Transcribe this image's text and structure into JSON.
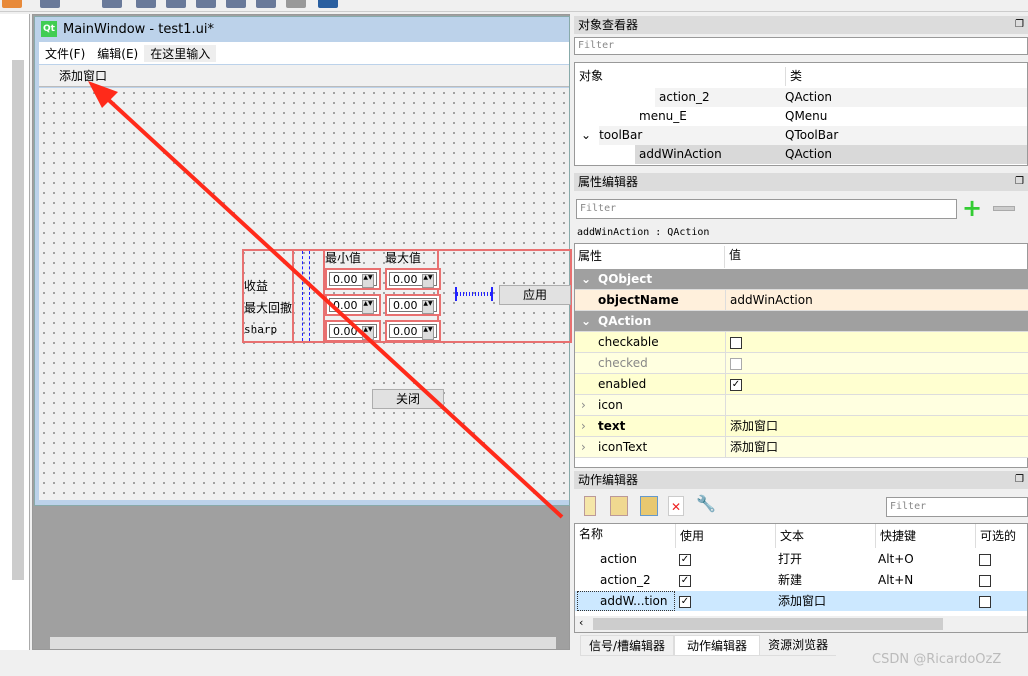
{
  "form_window": {
    "title": "MainWindow - test1.ui*",
    "logo": "Qt",
    "menus": [
      "文件(F)",
      "编辑(E)",
      "在这里输入"
    ],
    "toolbar_action": "添加窗口"
  },
  "form": {
    "labels": [
      "收益",
      "最大回撤",
      "sharp"
    ],
    "headers": [
      "最小值",
      "最大值"
    ],
    "spin_values": [
      "0.00",
      "0.00",
      "0.00",
      "0.00",
      "0.00",
      "0.00"
    ],
    "apply_button": "应用",
    "close_button": "关闭"
  },
  "object_inspector": {
    "title": "对象查看器",
    "filter_placeholder": "Filter",
    "columns": [
      "对象",
      "类"
    ],
    "rows": [
      {
        "name": "action_2",
        "class": "QAction"
      },
      {
        "name": "menu_E",
        "class": "QMenu"
      },
      {
        "name": "toolBar",
        "class": "QToolBar"
      },
      {
        "name": "addWinAction",
        "class": "QAction"
      }
    ]
  },
  "property_editor": {
    "title": "属性编辑器",
    "filter_placeholder": "Filter",
    "object_label": "addWinAction : QAction",
    "columns": [
      "属性",
      "值"
    ],
    "sections": {
      "qobject": "QObject",
      "qaction": "QAction"
    },
    "rows": [
      {
        "name": "objectName",
        "value": "addWinAction"
      },
      {
        "name": "checkable"
      },
      {
        "name": "checked"
      },
      {
        "name": "enabled"
      },
      {
        "name": "icon",
        "value": ""
      },
      {
        "name": "text",
        "value": "添加窗口"
      },
      {
        "name": "iconText",
        "value": "添加窗口"
      }
    ]
  },
  "action_editor": {
    "title": "动作编辑器",
    "filter_placeholder": "Filter",
    "columns": [
      "名称",
      "使用",
      "文本",
      "快捷键",
      "可选的"
    ],
    "rows": [
      {
        "name": "action",
        "text": "打开",
        "shortcut": "Alt+O"
      },
      {
        "name": "action_2",
        "text": "新建",
        "shortcut": "Alt+N"
      },
      {
        "name": "addW...tion",
        "text": "添加窗口",
        "shortcut": ""
      }
    ]
  },
  "bottom_tabs": [
    "信号/槽编辑器",
    "动作编辑器",
    "资源浏览器"
  ],
  "watermark": "CSDN @RicardoOzZ",
  "colors": {
    "annotation_arrow": "#ff2a1a",
    "selection": "#cce8ff",
    "layout_border": "#e87070"
  }
}
